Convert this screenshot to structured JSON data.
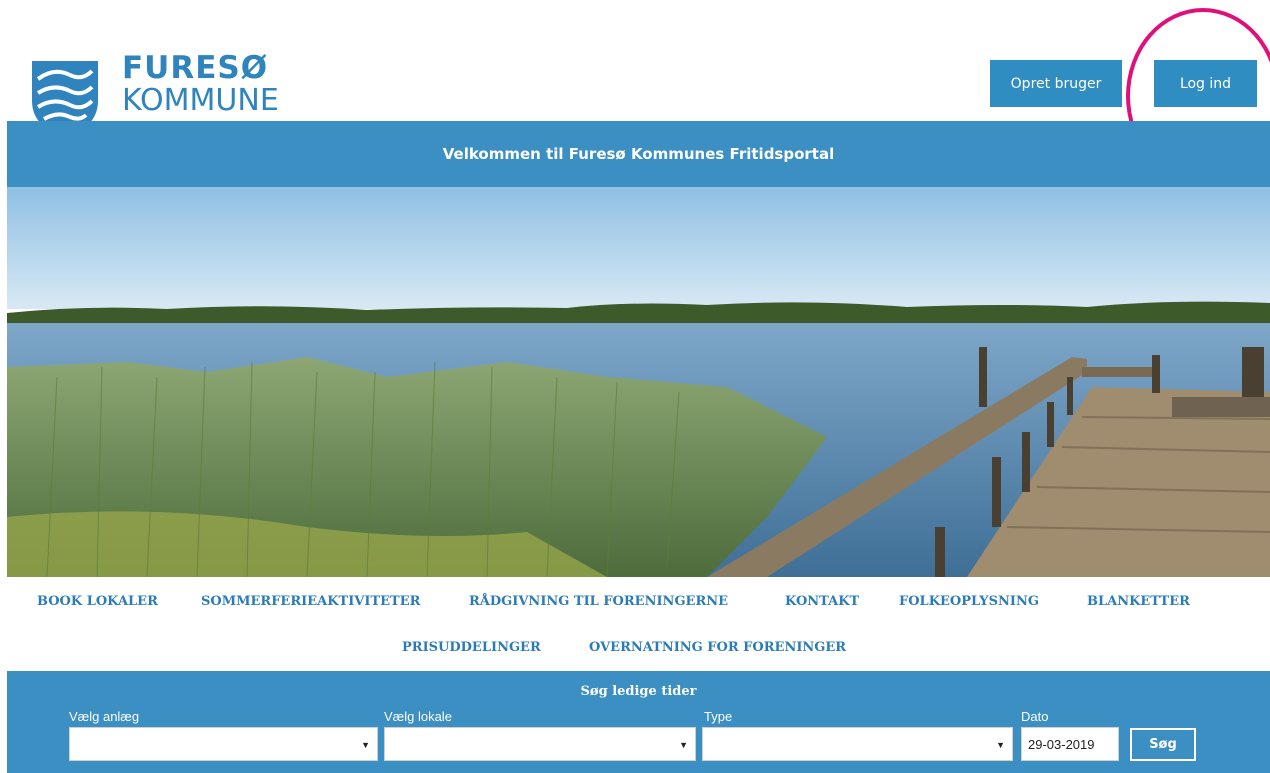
{
  "header": {
    "brand_line1": "FURESØ",
    "brand_line2": "KOMMUNE",
    "register_button": "Opret bruger",
    "login_button": "Log ind"
  },
  "welcome_text": "Velkommen til Furesø Kommunes Fritidsportal",
  "nav": {
    "items": [
      "BOOK LOKALER",
      "SOMMERFERIEAKTIVITETER",
      "RÅDGIVNING TIL FORENINGERNE",
      "KONTAKT",
      "FOLKEOPLYSNING",
      "BLANKETTER",
      "PRISUDDELINGER",
      "OVERNATNING FOR FORENINGER"
    ]
  },
  "search": {
    "title": "Søg ledige tider",
    "facility_label": "Vælg anlæg",
    "facility_value": "",
    "room_label": "Vælg lokale",
    "room_value": "",
    "type_label": "Type",
    "type_value": "",
    "date_label": "Dato",
    "date_value": "29-03-2019",
    "search_button": "Søg"
  },
  "icons": {
    "select_arrow": "▼"
  },
  "colors": {
    "brand_blue": "#3b8fc3",
    "button_blue": "#2f8dc1",
    "nav_text": "#2a7cb6",
    "highlight": "#e0107a"
  }
}
